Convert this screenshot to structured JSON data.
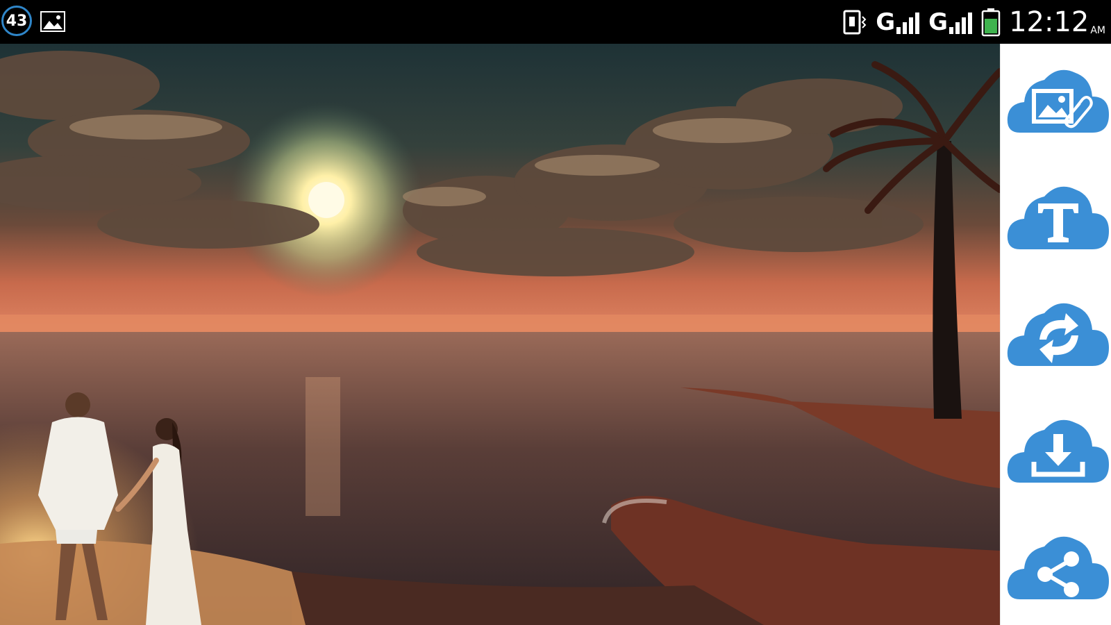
{
  "statusbar": {
    "notification_count": "43",
    "network_1": "G",
    "network_2": "G",
    "time": "12:12",
    "ampm": "AM"
  },
  "photo": {
    "description_icon": "beach-sunset-couple-photo"
  },
  "toolbar": {
    "buttons": [
      {
        "icon": "attach-photo-cloud-icon"
      },
      {
        "icon": "text-cloud-icon"
      },
      {
        "icon": "refresh-cloud-icon"
      },
      {
        "icon": "download-cloud-icon"
      },
      {
        "icon": "share-cloud-icon"
      }
    ]
  },
  "colors": {
    "accent": "#3b8fd6",
    "statusbar": "#000000",
    "toolbar_bg": "#ffffff"
  }
}
